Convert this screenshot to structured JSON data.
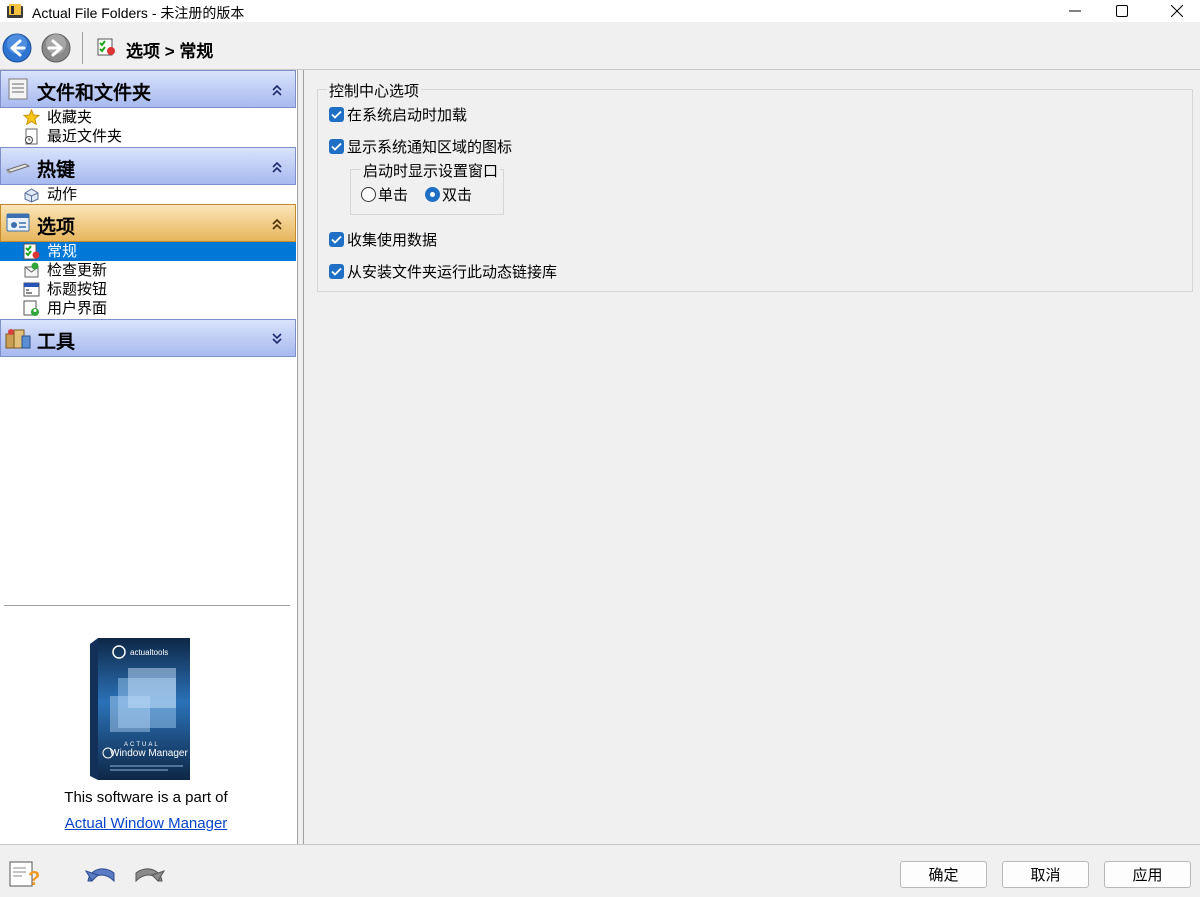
{
  "window": {
    "title": "Actual File Folders - 未注册的版本"
  },
  "toolbar": {
    "breadcrumb": "选项 > 常规"
  },
  "sidebar": {
    "groups": [
      {
        "title": "文件和文件夹",
        "items": [
          "收藏夹",
          "最近文件夹"
        ]
      },
      {
        "title": "热键",
        "items": [
          "动作"
        ]
      },
      {
        "title": "选项",
        "items": [
          "常规",
          "检查更新",
          "标题按钮",
          "用户界面"
        ]
      },
      {
        "title": "工具",
        "items": []
      }
    ],
    "selected_item": "常规"
  },
  "promo": {
    "text": "This software is a part of",
    "link": "Actual Window Manager",
    "box_brand": "actualtools",
    "box_title_small": "ACTUAL",
    "box_title": "Window Manager"
  },
  "settings": {
    "group_title": "控制中心选项",
    "options": [
      {
        "label": "在系统启动时加载",
        "checked": true
      },
      {
        "label": "显示系统通知区域的图标",
        "checked": true
      },
      {
        "label": "收集使用数据",
        "checked": true
      },
      {
        "label": "从安装文件夹运行此动态链接库",
        "checked": true
      }
    ],
    "startup_group_title": "启动时显示设置窗口",
    "startup_radios": [
      {
        "label": "单击",
        "selected": false
      },
      {
        "label": "双击",
        "selected": true
      }
    ]
  },
  "buttons": {
    "ok": "确定",
    "cancel": "取消",
    "apply": "应用"
  },
  "colors": {
    "group_header": "#a7b9ef",
    "active_group_header": "#e7b55c",
    "selection": "#0078d7",
    "checkbox": "#1f6fc5",
    "link": "#0645c8"
  }
}
